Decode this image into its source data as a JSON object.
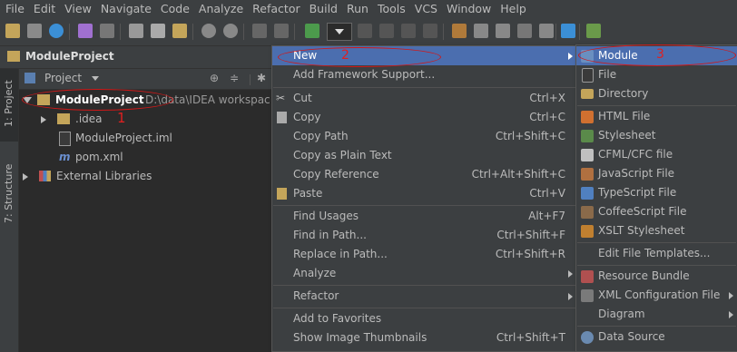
{
  "menubar": [
    "File",
    "Edit",
    "View",
    "Navigate",
    "Code",
    "Analyze",
    "Refactor",
    "Build",
    "Run",
    "Tools",
    "VCS",
    "Window",
    "Help"
  ],
  "navbar": {
    "project": "ModuleProject"
  },
  "side_tabs": {
    "project": "1: Project",
    "structure": "7: Structure"
  },
  "panel": {
    "selector": "Project"
  },
  "tree": {
    "root": {
      "name": "ModuleProject",
      "path": "D:\\data\\IDEA workspac"
    },
    "idea": ".idea",
    "iml": "ModuleProject.iml",
    "pom": "pom.xml",
    "ext": "External Libraries"
  },
  "annotations": {
    "a1": "1",
    "a2": "2",
    "a3": "3"
  },
  "context_menu": [
    {
      "label": "New",
      "shortcut": ""
    },
    {
      "label": "Add Framework Support...",
      "shortcut": ""
    },
    {
      "label": "Cut",
      "shortcut": "Ctrl+X"
    },
    {
      "label": "Copy",
      "shortcut": "Ctrl+C"
    },
    {
      "label": "Copy Path",
      "shortcut": "Ctrl+Shift+C"
    },
    {
      "label": "Copy as Plain Text",
      "shortcut": ""
    },
    {
      "label": "Copy Reference",
      "shortcut": "Ctrl+Alt+Shift+C"
    },
    {
      "label": "Paste",
      "shortcut": "Ctrl+V"
    },
    {
      "label": "Find Usages",
      "shortcut": "Alt+F7"
    },
    {
      "label": "Find in Path...",
      "shortcut": "Ctrl+Shift+F"
    },
    {
      "label": "Replace in Path...",
      "shortcut": "Ctrl+Shift+R"
    },
    {
      "label": "Analyze",
      "shortcut": ""
    },
    {
      "label": "Refactor",
      "shortcut": ""
    },
    {
      "label": "Add to Favorites",
      "shortcut": ""
    },
    {
      "label": "Show Image Thumbnails",
      "shortcut": "Ctrl+Shift+T"
    }
  ],
  "new_submenu": [
    "Module",
    "File",
    "Directory",
    "HTML File",
    "Stylesheet",
    "CFML/CFC file",
    "JavaScript File",
    "TypeScript File",
    "CoffeeScript File",
    "XSLT Stylesheet",
    "Edit File Templates...",
    "Resource Bundle",
    "XML Configuration File",
    "Diagram",
    "Data Source"
  ],
  "colors": {
    "selection": "#4b6eaf",
    "annotation": "#d01818",
    "folder": "#c4a55a"
  }
}
